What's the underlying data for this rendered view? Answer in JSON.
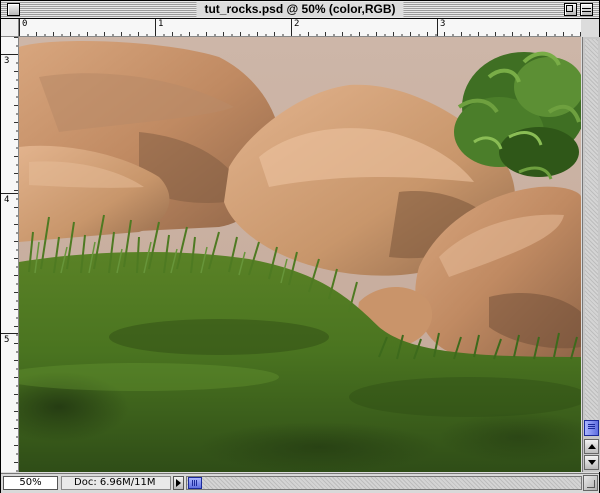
{
  "window": {
    "title": "tut_rocks.psd @ 50% (color,RGB)"
  },
  "rulers": {
    "top_labels": [
      "0",
      "1",
      "2",
      "3"
    ],
    "left_labels": [
      "3",
      "4",
      "5"
    ]
  },
  "status_bar": {
    "zoom": "50%",
    "doc_info": "Doc: 6.96M/11M"
  },
  "icons": {
    "close_box": "close-box-icon",
    "zoom_box": "zoom-box-icon",
    "collapse_box": "collapse-box-icon",
    "scroll_up": "scroll-up-arrow-icon",
    "scroll_down": "scroll-down-arrow-icon",
    "status_menu": "status-menu-arrow-icon",
    "resize": "resize-grip-icon"
  },
  "colors": {
    "scrollbar_thumb": "#5f6fe0",
    "sky": "#c9b2a3",
    "rock": "#c8966b",
    "grass": "#4f7a1f",
    "foliage": "#3f6f23"
  }
}
